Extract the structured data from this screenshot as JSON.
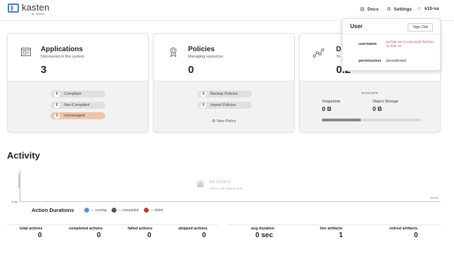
{
  "header": {
    "brand": "kasten",
    "brand_sub": "by Veeam",
    "docs_label": "Docs",
    "settings_label": "Settings",
    "user_label": "k10-sa"
  },
  "applications": {
    "title": "Applications",
    "subtitle": "Discovered in this system",
    "count": "3",
    "compliant": {
      "n": "0",
      "label": "Compliant"
    },
    "non_compliant": {
      "n": "0",
      "label": "Non-Compliant"
    },
    "unmanaged": {
      "n": "3",
      "label": "Unmanaged"
    }
  },
  "policies": {
    "title": "Policies",
    "subtitle": "Managing resources",
    "count": "0",
    "backup": {
      "n": "0",
      "label": "Backup Policies"
    },
    "import": {
      "n": "0",
      "label": "Import Policies"
    },
    "new_label": "New Policy"
  },
  "data": {
    "title": "D",
    "subtitle": "To",
    "count": "0.2",
    "backups_label": "BACKUPS",
    "snapshots_label": "Snapshots",
    "snapshots_value": "0 B",
    "object_storage_label": "Object Storage",
    "object_storage_value": "0 B",
    "usage_fraction": 0.39
  },
  "user_menu": {
    "title": "User",
    "sign_out": "Sign Out",
    "username_label": "username",
    "username_value": "system:serviceaccount:kasten-io:k10-sa",
    "permissions_label": "permissions",
    "permissions_value": "unrestricted"
  },
  "activity": {
    "title": "Activity",
    "y_label": "Duration(sec)",
    "x_zero": "0 sec",
    "x_end": "Actions",
    "empty_title": "No Actions",
    "empty_sub": "Actions will appear here.",
    "durations_title": "Action Durations",
    "legend": [
      {
        "label": "— running",
        "color": "#4a9fd4"
      },
      {
        "label": "— completed",
        "color": "#555555"
      },
      {
        "label": "— failed",
        "color": "#c0392b"
      }
    ]
  },
  "stats": [
    {
      "label": "total actions",
      "value": "0"
    },
    {
      "label": "completed actions",
      "value": "0"
    },
    {
      "label": "failed actions",
      "value": "0"
    },
    {
      "label": "skipped actions",
      "value": "0"
    },
    {
      "label": "avg duration",
      "value": "0 sec"
    },
    {
      "label": "live artifacts",
      "value": "1"
    },
    {
      "label": "retired artifacts",
      "value": "0"
    }
  ]
}
